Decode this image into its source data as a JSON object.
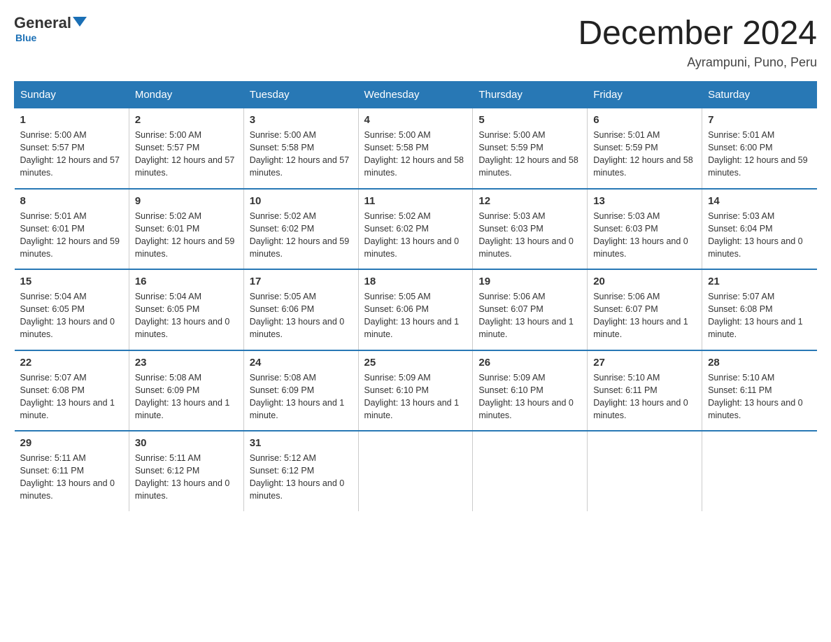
{
  "header": {
    "logo_general": "General",
    "logo_blue": "Blue",
    "month_title": "December 2024",
    "location": "Ayrampuni, Puno, Peru"
  },
  "days_of_week": [
    "Sunday",
    "Monday",
    "Tuesday",
    "Wednesday",
    "Thursday",
    "Friday",
    "Saturday"
  ],
  "weeks": [
    [
      {
        "num": "1",
        "sunrise": "5:00 AM",
        "sunset": "5:57 PM",
        "daylight": "12 hours and 57 minutes."
      },
      {
        "num": "2",
        "sunrise": "5:00 AM",
        "sunset": "5:57 PM",
        "daylight": "12 hours and 57 minutes."
      },
      {
        "num": "3",
        "sunrise": "5:00 AM",
        "sunset": "5:58 PM",
        "daylight": "12 hours and 57 minutes."
      },
      {
        "num": "4",
        "sunrise": "5:00 AM",
        "sunset": "5:58 PM",
        "daylight": "12 hours and 58 minutes."
      },
      {
        "num": "5",
        "sunrise": "5:00 AM",
        "sunset": "5:59 PM",
        "daylight": "12 hours and 58 minutes."
      },
      {
        "num": "6",
        "sunrise": "5:01 AM",
        "sunset": "5:59 PM",
        "daylight": "12 hours and 58 minutes."
      },
      {
        "num": "7",
        "sunrise": "5:01 AM",
        "sunset": "6:00 PM",
        "daylight": "12 hours and 59 minutes."
      }
    ],
    [
      {
        "num": "8",
        "sunrise": "5:01 AM",
        "sunset": "6:01 PM",
        "daylight": "12 hours and 59 minutes."
      },
      {
        "num": "9",
        "sunrise": "5:02 AM",
        "sunset": "6:01 PM",
        "daylight": "12 hours and 59 minutes."
      },
      {
        "num": "10",
        "sunrise": "5:02 AM",
        "sunset": "6:02 PM",
        "daylight": "12 hours and 59 minutes."
      },
      {
        "num": "11",
        "sunrise": "5:02 AM",
        "sunset": "6:02 PM",
        "daylight": "13 hours and 0 minutes."
      },
      {
        "num": "12",
        "sunrise": "5:03 AM",
        "sunset": "6:03 PM",
        "daylight": "13 hours and 0 minutes."
      },
      {
        "num": "13",
        "sunrise": "5:03 AM",
        "sunset": "6:03 PM",
        "daylight": "13 hours and 0 minutes."
      },
      {
        "num": "14",
        "sunrise": "5:03 AM",
        "sunset": "6:04 PM",
        "daylight": "13 hours and 0 minutes."
      }
    ],
    [
      {
        "num": "15",
        "sunrise": "5:04 AM",
        "sunset": "6:05 PM",
        "daylight": "13 hours and 0 minutes."
      },
      {
        "num": "16",
        "sunrise": "5:04 AM",
        "sunset": "6:05 PM",
        "daylight": "13 hours and 0 minutes."
      },
      {
        "num": "17",
        "sunrise": "5:05 AM",
        "sunset": "6:06 PM",
        "daylight": "13 hours and 0 minutes."
      },
      {
        "num": "18",
        "sunrise": "5:05 AM",
        "sunset": "6:06 PM",
        "daylight": "13 hours and 1 minute."
      },
      {
        "num": "19",
        "sunrise": "5:06 AM",
        "sunset": "6:07 PM",
        "daylight": "13 hours and 1 minute."
      },
      {
        "num": "20",
        "sunrise": "5:06 AM",
        "sunset": "6:07 PM",
        "daylight": "13 hours and 1 minute."
      },
      {
        "num": "21",
        "sunrise": "5:07 AM",
        "sunset": "6:08 PM",
        "daylight": "13 hours and 1 minute."
      }
    ],
    [
      {
        "num": "22",
        "sunrise": "5:07 AM",
        "sunset": "6:08 PM",
        "daylight": "13 hours and 1 minute."
      },
      {
        "num": "23",
        "sunrise": "5:08 AM",
        "sunset": "6:09 PM",
        "daylight": "13 hours and 1 minute."
      },
      {
        "num": "24",
        "sunrise": "5:08 AM",
        "sunset": "6:09 PM",
        "daylight": "13 hours and 1 minute."
      },
      {
        "num": "25",
        "sunrise": "5:09 AM",
        "sunset": "6:10 PM",
        "daylight": "13 hours and 1 minute."
      },
      {
        "num": "26",
        "sunrise": "5:09 AM",
        "sunset": "6:10 PM",
        "daylight": "13 hours and 0 minutes."
      },
      {
        "num": "27",
        "sunrise": "5:10 AM",
        "sunset": "6:11 PM",
        "daylight": "13 hours and 0 minutes."
      },
      {
        "num": "28",
        "sunrise": "5:10 AM",
        "sunset": "6:11 PM",
        "daylight": "13 hours and 0 minutes."
      }
    ],
    [
      {
        "num": "29",
        "sunrise": "5:11 AM",
        "sunset": "6:11 PM",
        "daylight": "13 hours and 0 minutes."
      },
      {
        "num": "30",
        "sunrise": "5:11 AM",
        "sunset": "6:12 PM",
        "daylight": "13 hours and 0 minutes."
      },
      {
        "num": "31",
        "sunrise": "5:12 AM",
        "sunset": "6:12 PM",
        "daylight": "13 hours and 0 minutes."
      },
      {
        "num": "",
        "sunrise": "",
        "sunset": "",
        "daylight": ""
      },
      {
        "num": "",
        "sunrise": "",
        "sunset": "",
        "daylight": ""
      },
      {
        "num": "",
        "sunrise": "",
        "sunset": "",
        "daylight": ""
      },
      {
        "num": "",
        "sunrise": "",
        "sunset": "",
        "daylight": ""
      }
    ]
  ],
  "labels": {
    "sunrise_prefix": "Sunrise: ",
    "sunset_prefix": "Sunset: ",
    "daylight_prefix": "Daylight: "
  }
}
